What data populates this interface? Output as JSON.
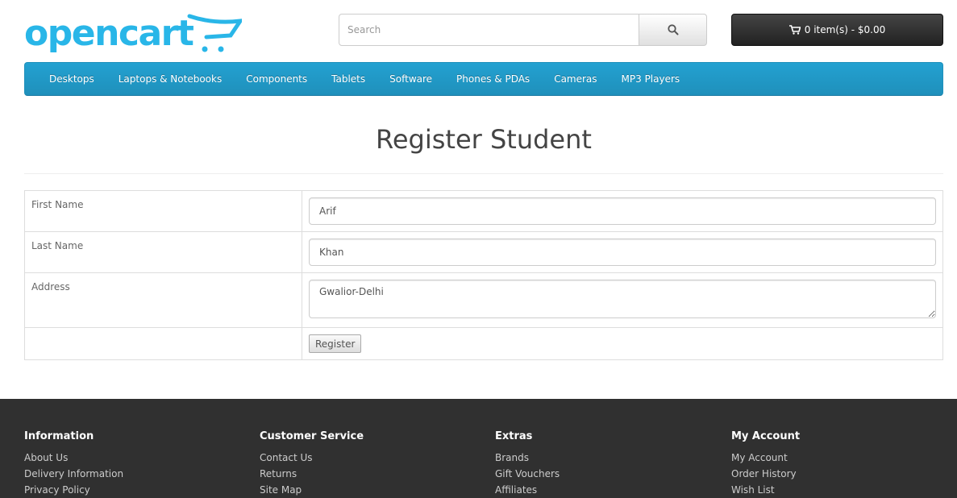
{
  "header": {
    "logo_text": "opencart",
    "search_placeholder": "Search",
    "cart_label": "0 item(s) - $0.00"
  },
  "menu": [
    "Desktops",
    "Laptops & Notebooks",
    "Components",
    "Tablets",
    "Software",
    "Phones & PDAs",
    "Cameras",
    "MP3 Players"
  ],
  "page": {
    "title": "Register Student"
  },
  "form": {
    "first_name_label": "First Name",
    "first_name_value": "Arif",
    "last_name_label": "Last Name",
    "last_name_value": "Khan",
    "address_label": "Address",
    "address_value": "Gwalior-Delhi",
    "register_label": "Register"
  },
  "footer": {
    "columns": [
      {
        "title": "Information",
        "links": [
          "About Us",
          "Delivery Information",
          "Privacy Policy"
        ]
      },
      {
        "title": "Customer Service",
        "links": [
          "Contact Us",
          "Returns",
          "Site Map"
        ]
      },
      {
        "title": "Extras",
        "links": [
          "Brands",
          "Gift Vouchers",
          "Affiliates"
        ]
      },
      {
        "title": "My Account",
        "links": [
          "My Account",
          "Order History",
          "Wish List"
        ]
      }
    ]
  },
  "colors": {
    "brand": "#23a1d1",
    "footer_bg": "#303030",
    "cart_bg": "#222222"
  },
  "icons": {
    "search": "search-icon",
    "cart": "shopping-cart-icon",
    "logo_cart": "cart-logo-icon"
  }
}
